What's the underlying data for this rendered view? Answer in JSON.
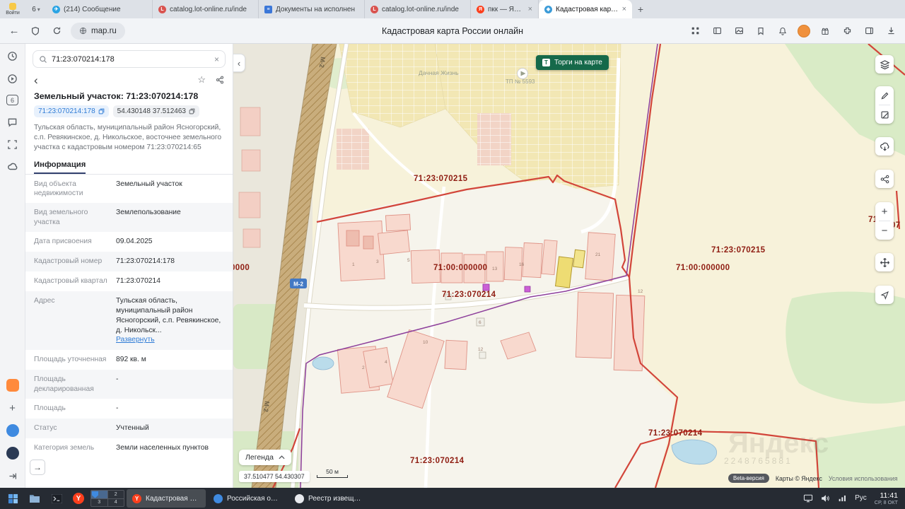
{
  "browser": {
    "profile_label": "Войти",
    "tab_counter": "6",
    "tabs": [
      {
        "label": "(214) Сообщение"
      },
      {
        "label": "catalog.lot-online.ru/inde"
      },
      {
        "label": "Документы на исполнен"
      },
      {
        "label": "catalog.lot-online.ru/inde"
      },
      {
        "label": "пкк — Яндекс: нашлось"
      },
      {
        "label": "Кадастровая карта Ро"
      }
    ],
    "address": "map.ru",
    "page_title": "Кадастровая карта России онлайн"
  },
  "sidebar": {
    "badge": "6"
  },
  "panel": {
    "search_value": "71:23:070214:178",
    "title": "Земельный участок: 71:23:070214:178",
    "chip_cadnum": "71:23:070214:178",
    "chip_coords": "54.430148 37.512463",
    "description": "Тульская область, муниципальный район Ясногорский, с.п. Ревякинское, д. Никольское, восточнее земельного участка с кадастровым номером 71:23:070214:65",
    "tab_info": "Информация",
    "rows": [
      {
        "label": "Вид объекта недвижимости",
        "value": "Земельный участок"
      },
      {
        "label": "Вид земельного участка",
        "value": "Землепользование"
      },
      {
        "label": "Дата присвоения",
        "value": "09.04.2025"
      },
      {
        "label": "Кадастровый номер",
        "value": "71:23:070214:178"
      },
      {
        "label": "Кадастровый квартал",
        "value": "71:23:070214"
      },
      {
        "label": "Адрес",
        "value": "Тульская область, муниципальный район Ясногорский, с.п. Ревякинское, д. Никольск...",
        "link": "Развернуть"
      },
      {
        "label": "Площадь уточненная",
        "value": "892 кв. м"
      },
      {
        "label": "Площадь декларированная",
        "value": "-"
      },
      {
        "label": "Площадь",
        "value": "-"
      },
      {
        "label": "Статус",
        "value": "Учтенный"
      },
      {
        "label": "Категория земель",
        "value": "Земли населенных пунктов"
      }
    ]
  },
  "map": {
    "torgi_button": "Торги на карте",
    "legend_button": "Легенда",
    "coords_bar": "37.510477 54.430307",
    "scale_label": "50 м",
    "attribution": {
      "beta": "Beta-версия",
      "copyright": "Карты © Яндекс",
      "terms": "Условия использования"
    },
    "watermark": "Яндекс",
    "watermark_digits": "2248765881",
    "quarter_labels": {
      "q215_left": "71:23:070215",
      "q000_left": "71:00:000000",
      "q214_center": "71:23:070214",
      "q000_cut": "0000",
      "q215_right": "71:23:070215",
      "q000_right": "71:00:000000",
      "q214_bottom_right": "71:23:070214",
      "q214_bottom_center": "71:23:070214",
      "cut_right_a": "71",
      "cut_right_b": "07"
    },
    "poi": {
      "dachnaya": "Дачная Жизнь",
      "tp": "ТП № 5593"
    },
    "road_m2": "М-2",
    "parcel_numbers": [
      "1",
      "3",
      "5",
      "13",
      "16",
      "21",
      "12",
      "6",
      "10",
      "12",
      "2",
      "4"
    ]
  },
  "taskbar": {
    "pager": [
      "2",
      "3",
      "4"
    ],
    "windows": [
      {
        "title": "Кадастровая кар..."
      },
      {
        "title": "Российская опер..."
      },
      {
        "title": "Реестр извещени..."
      }
    ],
    "lang": "Рус",
    "time": "11:41",
    "date": "СР, 8 ОКТ"
  },
  "colors": {
    "boundary_red": "#d2453a",
    "boundary_purple": "#8d3f9b",
    "quarter_label": "#8f1d12",
    "torgi_green": "#15694a",
    "selected_parcel": "#eedc73"
  }
}
